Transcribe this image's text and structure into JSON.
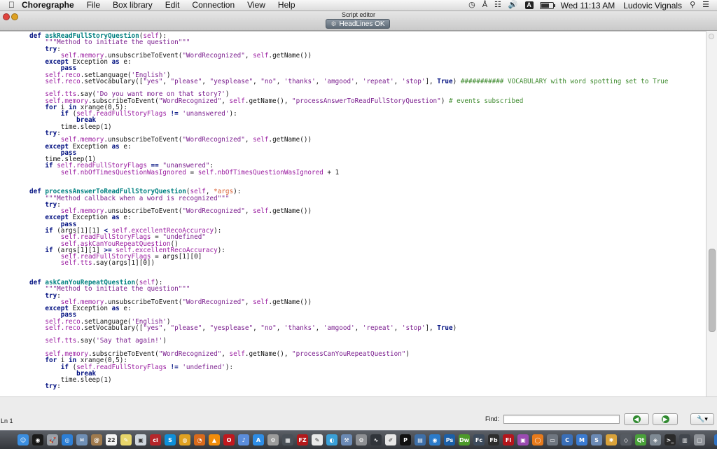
{
  "menubar": {
    "app_name": "Choregraphe",
    "items": [
      "File",
      "Box library",
      "Edit",
      "Connection",
      "View",
      "Help"
    ],
    "status": {
      "input_badge": "A",
      "clock": "Wed 11:13 AM",
      "user": "Ludovic Vignals"
    }
  },
  "window": {
    "title": "Script editor",
    "status_pill": "HeadLines OK"
  },
  "editor": {
    "lines": [
      [
        [
          "kw",
          "def "
        ],
        [
          "fn",
          "askReadFullStoryQuestion"
        ],
        [
          "",
          "("
        ],
        [
          "sf",
          "self"
        ],
        [
          "",
          "):"
        ]
      ],
      [
        [
          "",
          "    "
        ],
        [
          "st",
          "\"\"\"Method to initiate the question\"\"\""
        ]
      ],
      [
        [
          "",
          "    "
        ],
        [
          "kw",
          "try"
        ],
        [
          "",
          ":"
        ]
      ],
      [
        [
          "",
          "        "
        ],
        [
          "sf",
          "self.memory"
        ],
        [
          "",
          ".unsubscribeToEvent("
        ],
        [
          "st",
          "\"WordRecognized\""
        ],
        [
          "",
          ", "
        ],
        [
          "sf",
          "self"
        ],
        [
          "",
          ".getName())"
        ]
      ],
      [
        [
          "",
          "    "
        ],
        [
          "kw",
          "except "
        ],
        [
          "",
          "Exception "
        ],
        [
          "kw",
          "as "
        ],
        [
          "",
          "e:"
        ]
      ],
      [
        [
          "",
          "        "
        ],
        [
          "kw",
          "pass"
        ]
      ],
      [
        [
          "",
          "    "
        ],
        [
          "sf",
          "self.reco"
        ],
        [
          "",
          ".setLanguage("
        ],
        [
          "st",
          "'English'"
        ],
        [
          "",
          ")"
        ]
      ],
      [
        [
          "",
          "    "
        ],
        [
          "sf",
          "self.reco"
        ],
        [
          "",
          ".setVocabulary(["
        ],
        [
          "st",
          "\"yes\""
        ],
        [
          "",
          ", "
        ],
        [
          "st",
          "\"please\""
        ],
        [
          "",
          ", "
        ],
        [
          "st",
          "\"yesplease\""
        ],
        [
          "",
          ", "
        ],
        [
          "st",
          "\"no\""
        ],
        [
          "",
          ", "
        ],
        [
          "st",
          "'thanks'"
        ],
        [
          "",
          ", "
        ],
        [
          "st",
          "'amgood'"
        ],
        [
          "",
          ", "
        ],
        [
          "st",
          "'repeat'"
        ],
        [
          "",
          ", "
        ],
        [
          "st",
          "'stop'"
        ],
        [
          "",
          "], "
        ],
        [
          "kw",
          "True"
        ],
        [
          "",
          ") "
        ],
        [
          "cm",
          "########### VOCABULARY with word spotting set to True"
        ]
      ],
      [],
      [
        [
          "",
          "    "
        ],
        [
          "sf",
          "self.tts"
        ],
        [
          "",
          ".say("
        ],
        [
          "st",
          "'Do you want more on that story?'"
        ],
        [
          "",
          ")"
        ]
      ],
      [
        [
          "",
          "    "
        ],
        [
          "sf",
          "self.memory"
        ],
        [
          "",
          ".subscribeToEvent("
        ],
        [
          "st",
          "\"WordRecognized\""
        ],
        [
          "",
          ", "
        ],
        [
          "sf",
          "self"
        ],
        [
          "",
          ".getName(), "
        ],
        [
          "st",
          "\"processAnswerToReadFullStoryQuestion\""
        ],
        [
          "",
          ") "
        ],
        [
          "cm",
          "# events subscribed"
        ]
      ],
      [
        [
          "",
          "    "
        ],
        [
          "kw",
          "for "
        ],
        [
          "",
          "i "
        ],
        [
          "kw",
          "in "
        ],
        [
          "",
          "xrange(0,5):"
        ]
      ],
      [
        [
          "",
          "        "
        ],
        [
          "kw",
          "if "
        ],
        [
          "",
          "("
        ],
        [
          "sf",
          "self.readFullStoryFlags"
        ],
        [
          "kw",
          " != "
        ],
        [
          "st",
          "'unanswered'"
        ],
        [
          "",
          "):"
        ]
      ],
      [
        [
          "",
          "            "
        ],
        [
          "kw",
          "break"
        ]
      ],
      [
        [
          "",
          "        "
        ],
        [
          "",
          "time.sleep(1)"
        ]
      ],
      [
        [
          "",
          "    "
        ],
        [
          "kw",
          "try"
        ],
        [
          "",
          ":"
        ]
      ],
      [
        [
          "",
          "        "
        ],
        [
          "sf",
          "self.memory"
        ],
        [
          "",
          ".unsubscribeToEvent("
        ],
        [
          "st",
          "\"WordRecognized\""
        ],
        [
          "",
          ", "
        ],
        [
          "sf",
          "self"
        ],
        [
          "",
          ".getName())"
        ]
      ],
      [
        [
          "",
          "    "
        ],
        [
          "kw",
          "except "
        ],
        [
          "",
          "Exception "
        ],
        [
          "kw",
          "as "
        ],
        [
          "",
          "e:"
        ]
      ],
      [
        [
          "",
          "        "
        ],
        [
          "kw",
          "pass"
        ]
      ],
      [
        [
          "",
          "    "
        ],
        [
          "",
          "time.sleep(1)"
        ]
      ],
      [
        [
          "",
          "    "
        ],
        [
          "kw",
          "if "
        ],
        [
          "sf",
          "self.readFullStoryFlags"
        ],
        [
          "kw",
          " == "
        ],
        [
          "st",
          "\"unanswered\""
        ],
        [
          "",
          ":"
        ]
      ],
      [
        [
          "",
          "        "
        ],
        [
          "sf",
          "self.nbOfTimesQuestionWasIgnored"
        ],
        [
          "",
          " = "
        ],
        [
          "sf",
          "self.nbOfTimesQuestionWasIgnored"
        ],
        [
          "",
          " + 1"
        ]
      ],
      [],
      [],
      [
        [
          "kw",
          "def "
        ],
        [
          "fn",
          "processAnswerToReadFullStoryQuestion"
        ],
        [
          "",
          "("
        ],
        [
          "sf",
          "self"
        ],
        [
          "",
          ", "
        ],
        [
          "ar",
          "*args"
        ],
        [
          "",
          "):"
        ]
      ],
      [
        [
          "",
          "    "
        ],
        [
          "st",
          "\"\"\"Method callback when a word is recognized\"\"\""
        ]
      ],
      [
        [
          "",
          "    "
        ],
        [
          "kw",
          "try"
        ],
        [
          "",
          ":"
        ]
      ],
      [
        [
          "",
          "        "
        ],
        [
          "sf",
          "self.memory"
        ],
        [
          "",
          ".unsubscribeToEvent("
        ],
        [
          "st",
          "\"WordRecognized\""
        ],
        [
          "",
          ", "
        ],
        [
          "sf",
          "self"
        ],
        [
          "",
          ".getName())"
        ]
      ],
      [
        [
          "",
          "    "
        ],
        [
          "kw",
          "except "
        ],
        [
          "",
          "Exception "
        ],
        [
          "kw",
          "as "
        ],
        [
          "",
          "e:"
        ]
      ],
      [
        [
          "",
          "        "
        ],
        [
          "kw",
          "pass"
        ]
      ],
      [
        [
          "",
          "    "
        ],
        [
          "kw",
          "if "
        ],
        [
          "",
          "(args[1][1] "
        ],
        [
          "kw",
          "< "
        ],
        [
          "sf",
          "self.excellentRecoAccuracy"
        ],
        [
          "",
          "):"
        ]
      ],
      [
        [
          "",
          "        "
        ],
        [
          "sf",
          "self.readFullStoryFlags"
        ],
        [
          "",
          " = "
        ],
        [
          "st",
          "\"undefined\""
        ]
      ],
      [
        [
          "",
          "        "
        ],
        [
          "sf",
          "self.askCanYouRepeatQuestion"
        ],
        [
          "",
          "()"
        ]
      ],
      [
        [
          "",
          "    "
        ],
        [
          "kw",
          "if "
        ],
        [
          "",
          "(args[1][1] "
        ],
        [
          "kw",
          ">= "
        ],
        [
          "sf",
          "self.excellentRecoAccuracy"
        ],
        [
          "",
          "):"
        ]
      ],
      [
        [
          "",
          "        "
        ],
        [
          "sf",
          "self.readFullStoryFlags"
        ],
        [
          "",
          " = args[1][0]"
        ]
      ],
      [
        [
          "",
          "        "
        ],
        [
          "sf",
          "self.tts"
        ],
        [
          "",
          ".say(args[1][0])"
        ]
      ],
      [],
      [],
      [
        [
          "kw",
          "def "
        ],
        [
          "fn",
          "askCanYouRepeatQuestion"
        ],
        [
          "",
          "("
        ],
        [
          "sf",
          "self"
        ],
        [
          "",
          "):"
        ]
      ],
      [
        [
          "",
          "    "
        ],
        [
          "st",
          "\"\"\"Method to initiate the question\"\"\""
        ]
      ],
      [
        [
          "",
          "    "
        ],
        [
          "kw",
          "try"
        ],
        [
          "",
          ":"
        ]
      ],
      [
        [
          "",
          "        "
        ],
        [
          "sf",
          "self.memory"
        ],
        [
          "",
          ".unsubscribeToEvent("
        ],
        [
          "st",
          "\"WordRecognized\""
        ],
        [
          "",
          ", "
        ],
        [
          "sf",
          "self"
        ],
        [
          "",
          ".getName())"
        ]
      ],
      [
        [
          "",
          "    "
        ],
        [
          "kw",
          "except "
        ],
        [
          "",
          "Exception "
        ],
        [
          "kw",
          "as "
        ],
        [
          "",
          "e:"
        ]
      ],
      [
        [
          "",
          "        "
        ],
        [
          "kw",
          "pass"
        ]
      ],
      [
        [
          "",
          "    "
        ],
        [
          "sf",
          "self.reco"
        ],
        [
          "",
          ".setLanguage("
        ],
        [
          "st",
          "'English'"
        ],
        [
          "",
          ")"
        ]
      ],
      [
        [
          "",
          "    "
        ],
        [
          "sf",
          "self.reco"
        ],
        [
          "",
          ".setVocabulary(["
        ],
        [
          "st",
          "\"yes\""
        ],
        [
          "",
          ", "
        ],
        [
          "st",
          "\"please\""
        ],
        [
          "",
          ", "
        ],
        [
          "st",
          "\"yesplease\""
        ],
        [
          "",
          ", "
        ],
        [
          "st",
          "\"no\""
        ],
        [
          "",
          ", "
        ],
        [
          "st",
          "'thanks'"
        ],
        [
          "",
          ", "
        ],
        [
          "st",
          "'amgood'"
        ],
        [
          "",
          ", "
        ],
        [
          "st",
          "'repeat'"
        ],
        [
          "",
          ", "
        ],
        [
          "st",
          "'stop'"
        ],
        [
          "",
          "], "
        ],
        [
          "kw",
          "True"
        ],
        [
          "",
          ")"
        ]
      ],
      [],
      [
        [
          "",
          "    "
        ],
        [
          "sf",
          "self.tts"
        ],
        [
          "",
          ".say("
        ],
        [
          "st",
          "'Say that again!'"
        ],
        [
          "",
          ")"
        ]
      ],
      [],
      [
        [
          "",
          "    "
        ],
        [
          "sf",
          "self.memory"
        ],
        [
          "",
          ".subscribeToEvent("
        ],
        [
          "st",
          "\"WordRecognized\""
        ],
        [
          "",
          ", "
        ],
        [
          "sf",
          "self"
        ],
        [
          "",
          ".getName(), "
        ],
        [
          "st",
          "\"processCanYouRepeatQuestion\""
        ],
        [
          "",
          ")"
        ]
      ],
      [
        [
          "",
          "    "
        ],
        [
          "kw",
          "for "
        ],
        [
          "",
          "i "
        ],
        [
          "kw",
          "in "
        ],
        [
          "",
          "xrange(0,5):"
        ]
      ],
      [
        [
          "",
          "        "
        ],
        [
          "kw",
          "if "
        ],
        [
          "",
          "("
        ],
        [
          "sf",
          "self.readFullStoryFlags"
        ],
        [
          "kw",
          " != "
        ],
        [
          "st",
          "'undefined'"
        ],
        [
          "",
          "):"
        ]
      ],
      [
        [
          "",
          "            "
        ],
        [
          "kw",
          "break"
        ]
      ],
      [
        [
          "",
          "        "
        ],
        [
          "",
          "time.sleep(1)"
        ]
      ],
      [
        [
          "",
          "    "
        ],
        [
          "kw",
          "try"
        ],
        [
          "",
          ":"
        ]
      ]
    ]
  },
  "bottom": {
    "line_indicator": "Ln 1",
    "find_label": "Find:",
    "find_value": ""
  },
  "dock": [
    {
      "name": "finder-icon",
      "c": "#3b8ee0",
      "t": "☺"
    },
    {
      "name": "dashboard-icon",
      "c": "#1a1a1a",
      "t": "◉"
    },
    {
      "name": "launchpad-icon",
      "c": "#9aa0a8",
      "t": "🚀"
    },
    {
      "name": "safari-icon",
      "c": "#2d7fd6",
      "t": "◎"
    },
    {
      "name": "mail-icon",
      "c": "#6f8fb5",
      "t": "✉"
    },
    {
      "name": "contacts-icon",
      "c": "#a07b4e",
      "t": "@"
    },
    {
      "name": "calendar-icon",
      "c": "#f4f4f4",
      "t": "22"
    },
    {
      "name": "notes-icon",
      "c": "#e8d66b",
      "t": "✎"
    },
    {
      "name": "preview-icon",
      "c": "#cfd6dd",
      "t": "▣"
    },
    {
      "name": "cisco-icon",
      "c": "#b5262b",
      "t": "ci"
    },
    {
      "name": "skype-icon",
      "c": "#0e8fd9",
      "t": "S"
    },
    {
      "name": "chrome-icon",
      "c": "#e0a121",
      "t": "◍"
    },
    {
      "name": "firefox-icon",
      "c": "#d86a1c",
      "t": "◔"
    },
    {
      "name": "vlc-icon",
      "c": "#f08c0a",
      "t": "▲"
    },
    {
      "name": "opera-icon",
      "c": "#c0181e",
      "t": "O"
    },
    {
      "name": "itunes-icon",
      "c": "#5b8ddc",
      "t": "♪"
    },
    {
      "name": "app-store-icon",
      "c": "#2e8de6",
      "t": "A"
    },
    {
      "name": "keychain-icon",
      "c": "#9c9c9c",
      "t": "⚙"
    },
    {
      "name": "photo-icon",
      "c": "#4a5057",
      "t": "▦"
    },
    {
      "name": "filezilla-icon",
      "c": "#b3191b",
      "t": "FZ"
    },
    {
      "name": "pages-icon",
      "c": "#e9e9e9",
      "t": "✎"
    },
    {
      "name": "network-icon",
      "c": "#3aa0d8",
      "t": "◐"
    },
    {
      "name": "xcode-icon",
      "c": "#6b8ab5",
      "t": "⚒"
    },
    {
      "name": "system-prefs-icon",
      "c": "#8d8f93",
      "t": "⚙"
    },
    {
      "name": "activity-icon",
      "c": "#30343a",
      "t": "∿"
    },
    {
      "name": "textwrangler-icon",
      "c": "#e6e6e6",
      "t": "✐"
    },
    {
      "name": "terminal-icon",
      "c": "#111111",
      "t": "P"
    },
    {
      "name": "script-icon",
      "c": "#3e6fa8",
      "t": "▤"
    },
    {
      "name": "world-icon",
      "c": "#2b7bc9",
      "t": "◉"
    },
    {
      "name": "photoshop-icon",
      "c": "#1b5fa7",
      "t": "Ps"
    },
    {
      "name": "dreamweaver-icon",
      "c": "#4c9a2a",
      "t": "Dw"
    },
    {
      "name": "flash-catalyst-icon",
      "c": "#3d4b5c",
      "t": "Fc"
    },
    {
      "name": "flash-builder-icon",
      "c": "#2d2d2d",
      "t": "Fb"
    },
    {
      "name": "flash-icon",
      "c": "#b3161c",
      "t": "Fl"
    },
    {
      "name": "finder-window-icon",
      "c": "#9b4bb2",
      "t": "▣"
    },
    {
      "name": "globe-icon",
      "c": "#e77a1b",
      "t": "◯"
    },
    {
      "name": "folder-icon",
      "c": "#6f7680",
      "t": "▭"
    },
    {
      "name": "cm-icon",
      "c": "#3a6fb8",
      "t": "C"
    },
    {
      "name": "m-icon",
      "c": "#3b7bd1",
      "t": "M"
    },
    {
      "name": "s-icon",
      "c": "#6b8ab5",
      "t": "S"
    },
    {
      "name": "bee-icon",
      "c": "#d9a23a",
      "t": "✱"
    },
    {
      "name": "unity-icon",
      "c": "#555a61",
      "t": "◇"
    },
    {
      "name": "qt-icon",
      "c": "#4aa13b",
      "t": "Qt"
    },
    {
      "name": "robot-icon",
      "c": "#7f8a94",
      "t": "◈"
    },
    {
      "name": "terminal2-icon",
      "c": "#2a2a2a",
      "t": ">_"
    },
    {
      "name": "console-icon",
      "c": "#41464d",
      "t": "▥"
    },
    {
      "name": "screen-icon",
      "c": "#8f9399",
      "t": "▢"
    },
    {
      "name": "downloads-icon",
      "c": "#2f72c4",
      "t": "⬇"
    },
    {
      "name": "documents-icon",
      "c": "#7c8da3",
      "t": "▤"
    },
    {
      "name": "trash-icon",
      "c": "#b0b4ba",
      "t": "▥"
    }
  ]
}
